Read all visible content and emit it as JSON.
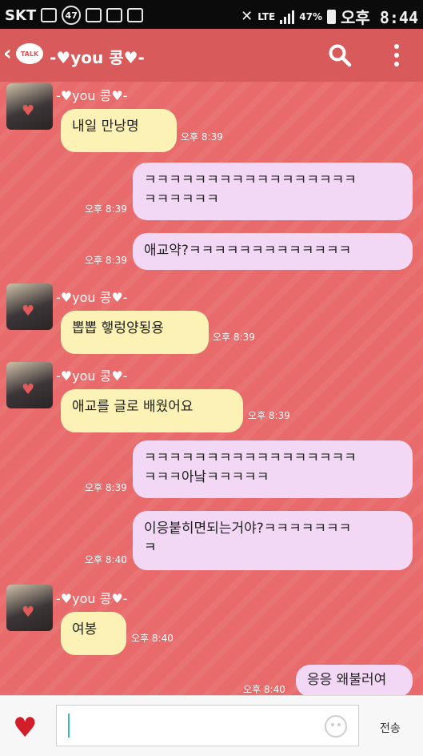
{
  "status_bar": {
    "carrier": "SKT",
    "badge": "47",
    "network": "LTE",
    "battery": "47%",
    "time": "오후 8:44"
  },
  "header": {
    "back_symbol": "‹",
    "talk_label": "TALK",
    "title": "-♥you 콩♥-"
  },
  "messages": [
    {
      "sender": "-♥you 콩♥-",
      "text": "내일 만낭명",
      "time": "오후 8:39"
    },
    {
      "text": "ㅋㅋㅋㅋㅋㅋㅋㅋㅋㅋㅋㅋㅋㅋㅋㅋㅋ\nㅋㅋㅋㅋㅋㅋ",
      "time": "오후 8:39"
    },
    {
      "text": "애교약?ㅋㅋㅋㅋㅋㅋㅋㅋㅋㅋㅋㅋㅋ",
      "time": "오후 8:39"
    },
    {
      "sender": "-♥you 콩♥-",
      "text": "뽑뽑 햏렁양됭용",
      "time": "오후 8:39"
    },
    {
      "sender": "-♥you 콩♥-",
      "text": "애교를 글로 배웠어요",
      "time": "오후 8:39"
    },
    {
      "text": "ㅋㅋㅋㅋㅋㅋㅋㅋㅋㅋㅋㅋㅋㅋㅋㅋㅋ\nㅋㅋㅋ아낰ㅋㅋㅋㅋㅋ",
      "time": "오후 8:39"
    },
    {
      "text": "이응붙히면되는거야?ㅋㅋㅋㅋㅋㅋㅋ\nㅋ",
      "time": "오후 8:40"
    },
    {
      "sender": "-♥you 콩♥-",
      "text": "여봉",
      "time": "오후 8:40"
    },
    {
      "text": "응응 왜불러여",
      "time": "오후 8:40"
    }
  ],
  "input_bar": {
    "send_label": "전송"
  },
  "colors": {
    "background": "#e86a6a",
    "header": "#d85a5a",
    "incoming_bubble": "#fdf2b6",
    "outgoing_bubble": "#f3d8f6"
  }
}
